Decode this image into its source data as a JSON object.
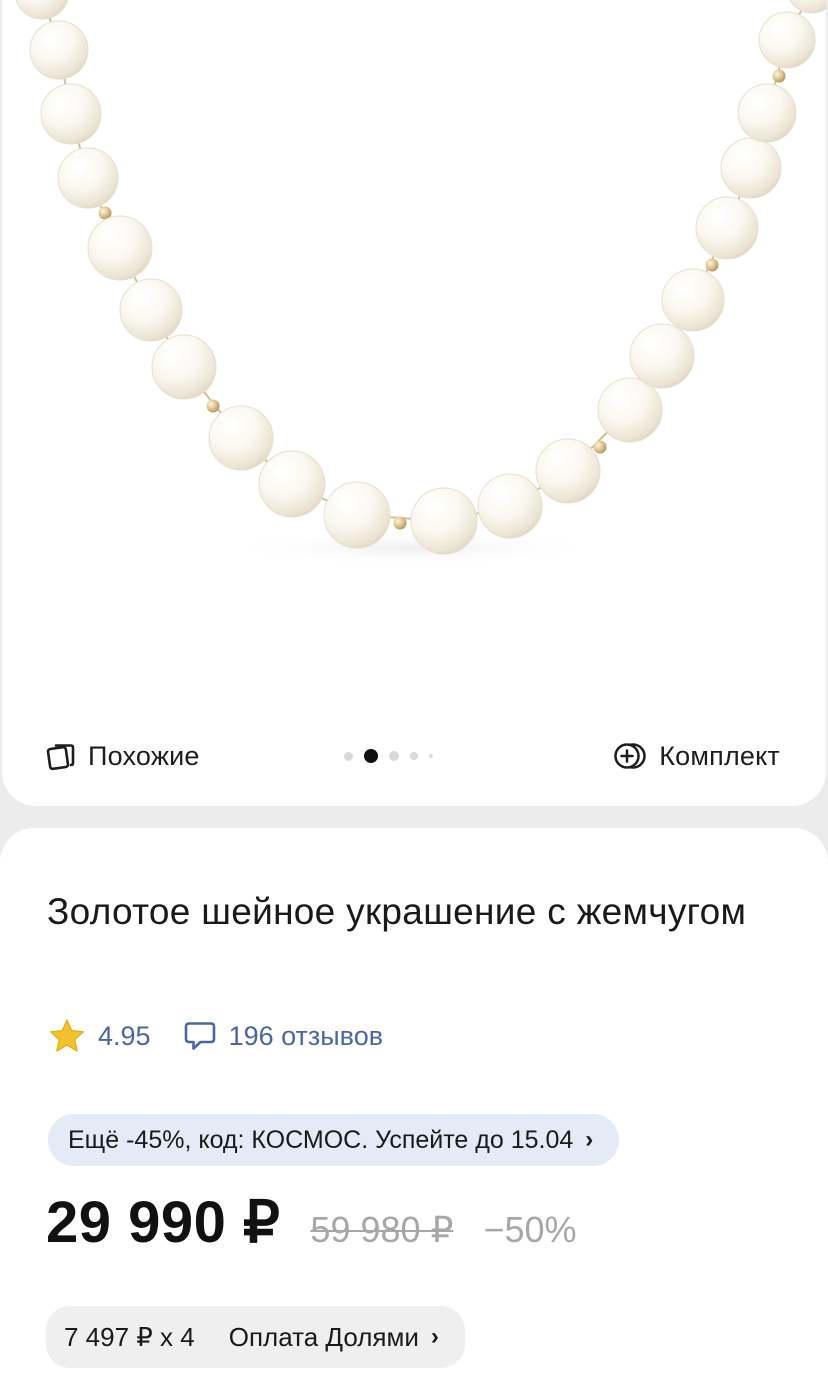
{
  "gallery": {
    "similar_label": "Похожие",
    "kit_label": "Комплект",
    "similar_icon": "cards-icon",
    "kit_icon": "plus-circle-icon",
    "dots_count": 5,
    "active_dot": 1
  },
  "product": {
    "title": "Золотое шейное украшение с жемчугом",
    "rating": "4.95",
    "reviews": "196 отзывов",
    "star_color": "#f2c12e",
    "link_color": "#4a66a8"
  },
  "promo": {
    "text": "Ещё -45%, код: КОСМОС. Успейте до 15.04",
    "chevron": "›"
  },
  "price": {
    "current": "29 990 ₽",
    "old": "59 980 ₽",
    "discount": "−50%"
  },
  "installment": {
    "amount": "7 497 ₽ x 4",
    "label": "Оплата Долями",
    "chevron": "›"
  }
}
